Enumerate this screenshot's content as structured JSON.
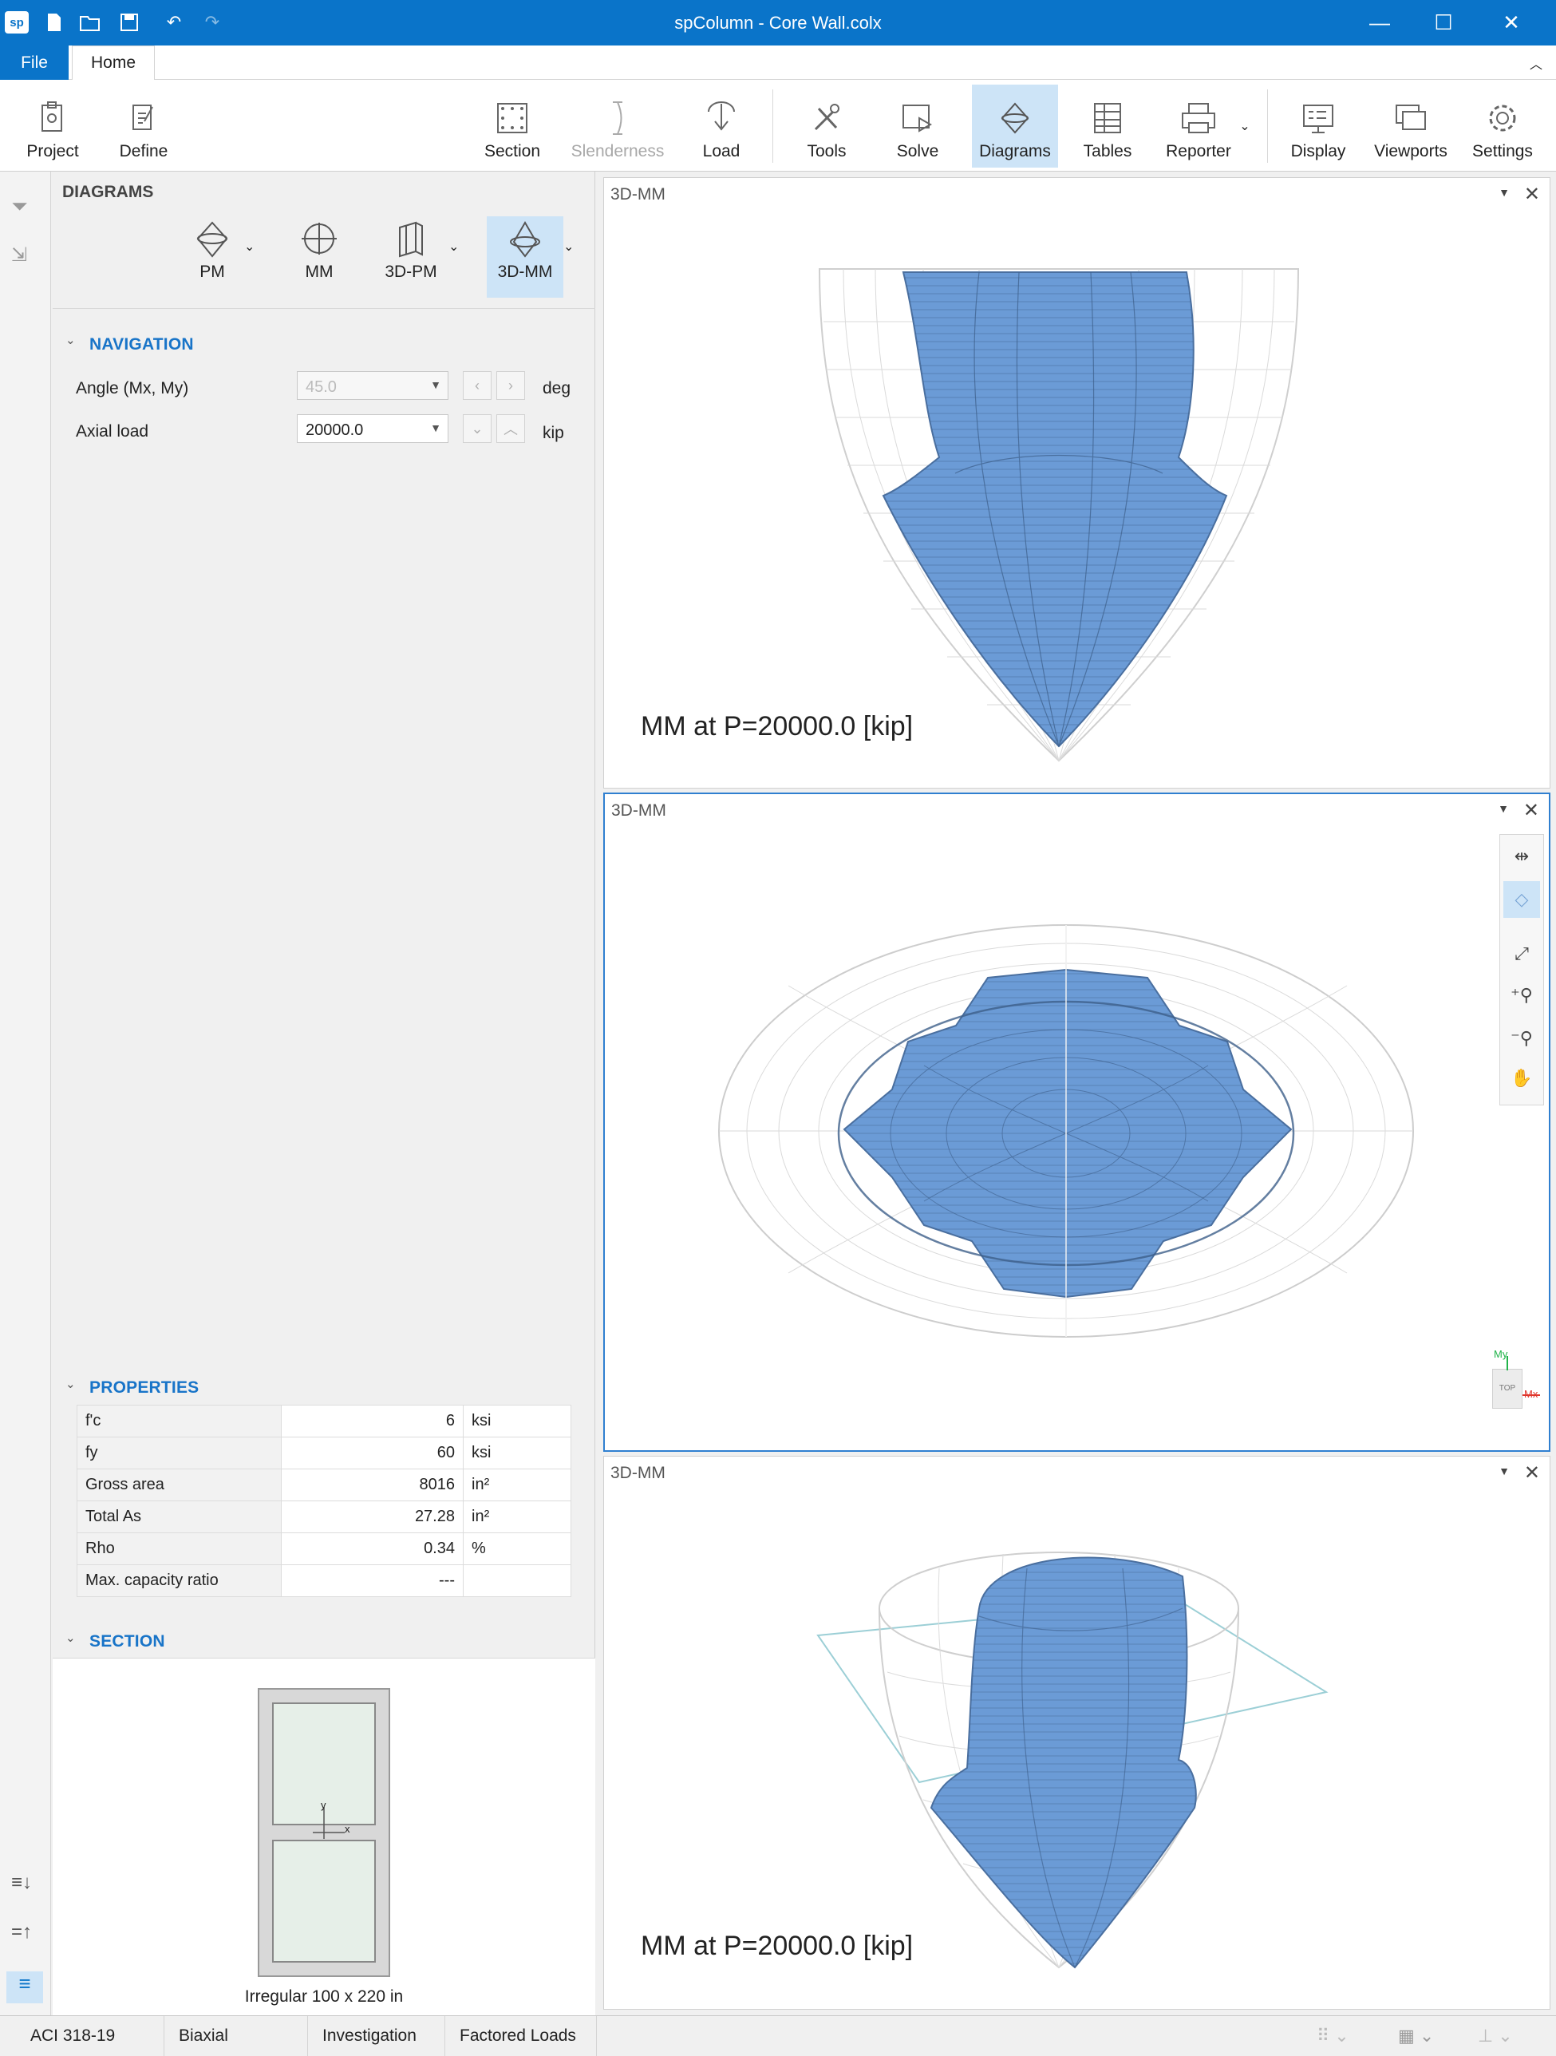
{
  "window": {
    "title": "spColumn - Core Wall.colx",
    "app_icon": "sp"
  },
  "ribbon_tabs": {
    "file": "File",
    "home": "Home"
  },
  "ribbon": {
    "project": "Project",
    "define": "Define",
    "section": "Section",
    "slenderness": "Slenderness",
    "load": "Load",
    "tools": "Tools",
    "solve": "Solve",
    "diagrams": "Diagrams",
    "tables": "Tables",
    "reporter": "Reporter",
    "display": "Display",
    "viewports": "Viewports",
    "settings": "Settings"
  },
  "panel": {
    "title": "DIAGRAMS",
    "diagram_types": {
      "pm": "PM",
      "mm": "MM",
      "pm3d": "3D-PM",
      "mm3d": "3D-MM"
    },
    "navigation": {
      "header": "NAVIGATION",
      "angle_label": "Angle (Mx, My)",
      "angle_value": "45.0",
      "angle_unit": "deg",
      "axial_label": "Axial load",
      "axial_value": "20000.0",
      "axial_unit": "kip"
    },
    "properties": {
      "header": "PROPERTIES",
      "rows": [
        {
          "name": "f'c",
          "value": "6",
          "unit": "ksi"
        },
        {
          "name": "fy",
          "value": "60",
          "unit": "ksi"
        },
        {
          "name": "Gross area",
          "value": "8016",
          "unit": "in²"
        },
        {
          "name": "Total As",
          "value": "27.28",
          "unit": "in²"
        },
        {
          "name": "Rho",
          "value": "0.34",
          "unit": "%"
        },
        {
          "name": "Max. capacity ratio",
          "value": "---",
          "unit": ""
        }
      ]
    },
    "section": {
      "header": "SECTION",
      "caption": "Irregular 100 x 220 in",
      "axis_y": "y",
      "axis_x": "x"
    }
  },
  "viewports": [
    {
      "title": "3D-MM",
      "caption": "MM at P=20000.0 [kip]"
    },
    {
      "title": "3D-MM",
      "caption": ""
    },
    {
      "title": "3D-MM",
      "caption": "MM at P=20000.0 [kip]"
    }
  ],
  "view_cube": {
    "face": "TOP",
    "axis_my": "My",
    "axis_mx": "Mx"
  },
  "statusbar": {
    "code": "ACI 318-19",
    "mode": "Biaxial",
    "run": "Investigation",
    "loads": "Factored Loads"
  },
  "colors": {
    "accent": "#0a74c9",
    "shape_fill": "#6b9bd6",
    "mesh": "#c8c8c8"
  }
}
